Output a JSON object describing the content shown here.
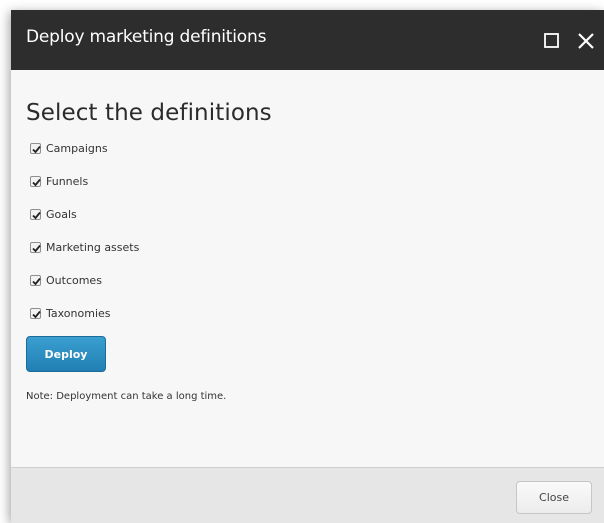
{
  "dialog": {
    "title": "Deploy marketing definitions",
    "heading": "Select the definitions",
    "options": [
      {
        "label": "Campaigns",
        "checked": true
      },
      {
        "label": "Funnels",
        "checked": true
      },
      {
        "label": "Goals",
        "checked": true
      },
      {
        "label": "Marketing assets",
        "checked": true
      },
      {
        "label": "Outcomes",
        "checked": true
      },
      {
        "label": "Taxonomies",
        "checked": true
      }
    ],
    "deploy_label": "Deploy",
    "note": "Note: Deployment can take a long time.",
    "close_label": "Close"
  },
  "icons": {
    "maximize": "maximize-icon",
    "close": "close-icon",
    "checkmark": "checkmark-icon"
  },
  "colors": {
    "titlebar": "#2d2d2d",
    "primary_button": "#2a8bc0",
    "background": "#f7f7f7",
    "footer": "#e6e6e6"
  }
}
